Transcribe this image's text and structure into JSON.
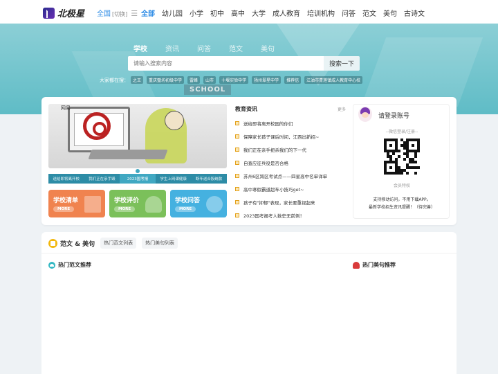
{
  "header": {
    "logo_text": "北极星",
    "city": "全国",
    "city_switch": "[切换]",
    "menu_icon": "menu-icon",
    "nav": [
      "全部",
      "幼儿园",
      "小学",
      "初中",
      "高中",
      "大学",
      "成人教育",
      "培训机构",
      "问答",
      "范文",
      "美句",
      "古诗文"
    ],
    "active_nav": "全部"
  },
  "hero": {
    "search_tabs": [
      "学校",
      "资讯",
      "问答",
      "范文",
      "美句"
    ],
    "active_tab": "学校",
    "search_placeholder": "请输入搜索内容",
    "search_button": "搜索一下",
    "hot_label": "大家都在搜：",
    "hot_tags": [
      "之王",
      "重庆璧坊初级中学",
      "雷峰",
      "山市",
      "十堰实验中学",
      "扬州翠星中学",
      "推荐信",
      "江油市青莲镇成人教育中心校"
    ],
    "sign_text": "SCHOOL"
  },
  "banner": {
    "corner_text": "网易",
    "tabs": [
      "送给即将离开校",
      "我们正在亲手毁",
      "2023国考报",
      "学生上网课健康",
      "断年送合股统款"
    ],
    "active_tab_index": 2
  },
  "tiles": [
    {
      "title": "学校清单",
      "more": "MORE",
      "color": "#f0834f"
    },
    {
      "title": "学校评价",
      "more": "MORE",
      "color": "#7bc05a"
    },
    {
      "title": "学校问答",
      "more": "MORE",
      "color": "#45b1e0"
    }
  ],
  "news": {
    "title": "教育资讯",
    "more": "更多",
    "items": [
      "送给即将离开校园的你们",
      "保障家长孩子课后时间，江西出新招~",
      "我们正在亲手扼杀我们的下一代",
      "自查应征兵役是否合格",
      "苏州6区跨区考试点——四星高中名单详单",
      "高中寒假霸道超车小技巧get~",
      "孩子有\"抑郁\"表现，家长要重视起来",
      "2023国考报考人数史无前例！"
    ]
  },
  "login": {
    "title": "请登录账号",
    "sub": "--微信登录/注册--",
    "vip": "会员特权",
    "line1": "支持移动访问，不用下载APP。",
    "line2": "最新学校招生资讯提醒！（待完善）"
  },
  "lower": {
    "title": "范文 & 美句",
    "pills": [
      "热门范文列表",
      "热门美句列表"
    ],
    "rec_left": "热门范文推荐",
    "rec_right": "热门美句推荐"
  }
}
